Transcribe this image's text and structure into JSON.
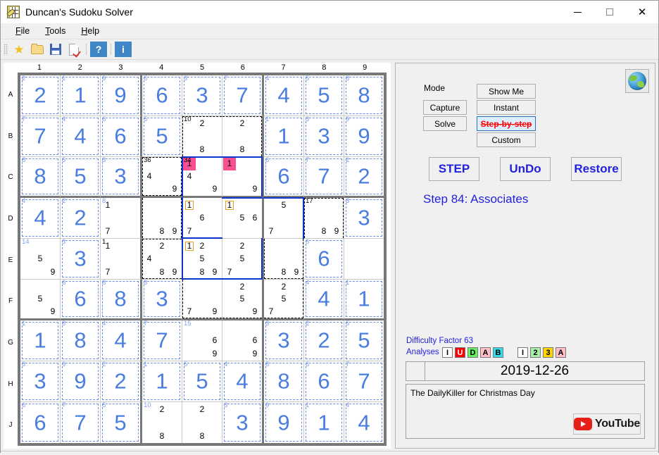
{
  "window": {
    "title": "Duncan's Sudoku Solver",
    "icon": "sudoku-app-icon",
    "minimize": "minimize-icon",
    "maximize": "maximize-icon",
    "close": "close-icon"
  },
  "menu": [
    {
      "label": "File"
    },
    {
      "label": "Tools"
    },
    {
      "label": "Help"
    }
  ],
  "toolbar": [
    {
      "name": "favorite-icon",
      "glyph": "★"
    },
    {
      "name": "open-folder-icon",
      "glyph": ""
    },
    {
      "name": "save-icon",
      "glyph": ""
    },
    {
      "name": "check-page-icon",
      "glyph": ""
    },
    {
      "name": "help-button",
      "glyph": "?"
    },
    {
      "name": "info-button",
      "glyph": "i"
    }
  ],
  "board": {
    "col_headers": [
      "1",
      "2",
      "3",
      "4",
      "5",
      "6",
      "7",
      "8",
      "9"
    ],
    "row_headers": [
      "A",
      "B",
      "C",
      "D",
      "E",
      "F",
      "G",
      "H",
      "J"
    ],
    "cells": [
      [
        {
          "cage": "2",
          "cageColor": "blue",
          "value": "2",
          "solved": true
        },
        {
          "cage": "1",
          "cageColor": "blue",
          "value": "1",
          "solved": true
        },
        {
          "cage": "9",
          "cageColor": "blue",
          "value": "9",
          "solved": true
        },
        {
          "cage": "6",
          "cageColor": "blue",
          "value": "6",
          "solved": true
        },
        {
          "cage": "3",
          "cageColor": "blue",
          "value": "3",
          "solved": true
        },
        {
          "cage": "7",
          "cageColor": "blue",
          "value": "7",
          "solved": true
        },
        {
          "cage": "4",
          "cageColor": "blue",
          "value": "4",
          "solved": true
        },
        {
          "cage": "5",
          "cageColor": "blue",
          "value": "5",
          "solved": true
        },
        {
          "cage": "8",
          "cageColor": "blue",
          "value": "8",
          "solved": true
        }
      ],
      [
        {
          "cage": "7",
          "cageColor": "blue",
          "value": "7",
          "solved": true
        },
        {
          "cage": "4",
          "cageColor": "blue",
          "value": "4",
          "solved": true
        },
        {
          "cage": "6",
          "cageColor": "blue",
          "value": "6",
          "solved": true
        },
        {
          "cage": "5",
          "cageColor": "blue",
          "value": "5",
          "solved": true
        },
        {
          "cage": "10",
          "cageColor": "black",
          "cands": [
            "",
            "2",
            "",
            "",
            "",
            "",
            "",
            "8",
            ""
          ],
          "cg": "TL"
        },
        {
          "cage": "",
          "cands": [
            "",
            "2",
            "",
            "",
            "",
            "",
            "",
            "8",
            ""
          ],
          "cg": "TR"
        },
        {
          "cage": "1",
          "cageColor": "blue",
          "value": "1",
          "solved": true
        },
        {
          "cage": "3",
          "cageColor": "blue",
          "value": "3",
          "solved": true
        },
        {
          "cage": "9",
          "cageColor": "blue",
          "value": "9",
          "solved": true
        }
      ],
      [
        {
          "cage": "8",
          "cageColor": "blue",
          "value": "8",
          "solved": true
        },
        {
          "cage": "5",
          "cageColor": "blue",
          "value": "5",
          "solved": true
        },
        {
          "cage": "3",
          "cageColor": "blue",
          "value": "3",
          "solved": true
        },
        {
          "cage": "36",
          "cageColor": "black",
          "cands": [
            "",
            "",
            "",
            "4",
            "",
            "",
            "",
            "",
            "9"
          ],
          "cg": "TLBR"
        },
        {
          "cage": "34",
          "cageColor": "black",
          "cands": [
            "1h",
            "",
            "",
            "4",
            "",
            "",
            "",
            "",
            "9"
          ],
          "cg": "TL",
          "sel": "TL"
        },
        {
          "cage": "",
          "cands": [
            "1h",
            "",
            "",
            "",
            "",
            "",
            "",
            "",
            "9"
          ],
          "cg": "TR",
          "sel": "TR"
        },
        {
          "cage": "6",
          "cageColor": "blue",
          "value": "6",
          "solved": true
        },
        {
          "cage": "7",
          "cageColor": "blue",
          "value": "7",
          "solved": true
        },
        {
          "cage": "2",
          "cageColor": "blue",
          "value": "2",
          "solved": true
        }
      ],
      [
        {
          "cage": "4",
          "cageColor": "blue",
          "value": "4",
          "solved": true
        },
        {
          "cage": "2",
          "cageColor": "blue",
          "value": "2",
          "solved": true
        },
        {
          "cage": "8",
          "cageColor": "blue",
          "cands": [
            "1",
            "",
            "",
            "",
            "",
            "",
            "7",
            "",
            ""
          ]
        },
        {
          "cage": "",
          "cands": [
            "",
            "",
            "",
            "",
            "",
            "",
            "",
            "8",
            "9"
          ],
          "cg": "LR"
        },
        {
          "cage": "",
          "cands": [
            "1b",
            "",
            "",
            "",
            "6",
            "",
            "7",
            "",
            ""
          ],
          "sel": "LB"
        },
        {
          "cage": "",
          "cands": [
            "1b",
            "",
            "",
            "",
            "5",
            "6",
            "",
            "",
            ""
          ],
          "sel": "T"
        },
        {
          "cage": "",
          "cands": [
            "",
            "5",
            "",
            "",
            "",
            "",
            "7",
            "",
            ""
          ],
          "sel": "TR"
        },
        {
          "cage": "17",
          "cageColor": "black",
          "cands": [
            "",
            "",
            "",
            "",
            "",
            "",
            "",
            "8",
            "9"
          ],
          "cg": "TLR"
        },
        {
          "cage": "3",
          "cageColor": "blue",
          "value": "3",
          "solved": true
        }
      ],
      [
        {
          "cage": "14",
          "cageColor": "blue",
          "cands": [
            "",
            "",
            "",
            "",
            "5",
            "",
            "",
            "",
            "9"
          ]
        },
        {
          "cage": "3",
          "cageColor": "blue",
          "value": "3",
          "solved": true
        },
        {
          "cage": "1",
          "cageColor": "",
          "cands": [
            "1",
            "",
            "",
            "",
            "",
            "",
            "7",
            "",
            ""
          ]
        },
        {
          "cage": "",
          "cands": [
            "",
            "2",
            "",
            "4",
            "",
            "",
            "",
            "8",
            "9"
          ],
          "cg": "TLB"
        },
        {
          "cage": "",
          "cands": [
            "1b",
            "2",
            "",
            "",
            "5",
            "",
            "",
            "8",
            "9"
          ],
          "sel": "LB"
        },
        {
          "cage": "",
          "cands": [
            "",
            "2",
            "",
            "",
            "5",
            "",
            "7",
            "",
            ""
          ],
          "sel": "RB"
        },
        {
          "cage": "",
          "cands": [
            "",
            "",
            "",
            "",
            "",
            "",
            "",
            "8",
            "9"
          ],
          "cg": "LRB"
        },
        {
          "cage": "6",
          "cageColor": "blue",
          "value": "6",
          "solved": true
        }
      ],
      [
        {
          "cage": "",
          "cands": [
            "",
            "",
            "",
            "",
            "5",
            "",
            "",
            "",
            "9"
          ]
        },
        {
          "cage": "6",
          "cageColor": "blue",
          "value": "6",
          "solved": true
        },
        {
          "cage": "8",
          "cageColor": "blue",
          "value": "8",
          "solved": true
        },
        {
          "cage": "3",
          "cageColor": "blue",
          "value": "3",
          "solved": true
        },
        {
          "cage": "",
          "cands": [
            "",
            "",
            "",
            "",
            "",
            "",
            "7",
            "",
            "9"
          ],
          "cg": "LB"
        },
        {
          "cage": "",
          "cands": [
            "",
            "2",
            "",
            "",
            "5",
            "",
            "",
            "",
            "9"
          ],
          "cg": "B"
        },
        {
          "cage": "",
          "cands": [
            "",
            "2",
            "",
            "",
            "5",
            "",
            "7",
            "",
            ""
          ],
          "cg": "BR"
        },
        {
          "cage": "4",
          "cageColor": "blue",
          "value": "4",
          "solved": true
        },
        {
          "cage": "1",
          "cageColor": "blue",
          "value": "1",
          "solved": true
        }
      ],
      [
        {
          "cage": "1",
          "cageColor": "blue",
          "value": "1",
          "solved": true
        },
        {
          "cage": "8",
          "cageColor": "blue",
          "value": "8",
          "solved": true
        },
        {
          "cage": "4",
          "cageColor": "blue",
          "value": "4",
          "solved": true
        },
        {
          "cage": "7",
          "cageColor": "blue",
          "value": "7",
          "solved": true
        },
        {
          "cage": "15",
          "cageColor": "blue",
          "cands": [
            "",
            "",
            "",
            "",
            "",
            "6",
            "",
            "",
            "9"
          ]
        },
        {
          "cage": "",
          "cands": [
            "",
            "",
            "",
            "",
            "",
            "6",
            "",
            "",
            "9"
          ]
        },
        {
          "cage": "3",
          "cageColor": "blue",
          "value": "3",
          "solved": true
        },
        {
          "cage": "2",
          "cageColor": "blue",
          "value": "2",
          "solved": true
        },
        {
          "cage": "5",
          "cageColor": "blue",
          "value": "5",
          "solved": true
        }
      ],
      [
        {
          "cage": "3",
          "cageColor": "blue",
          "value": "3",
          "solved": true
        },
        {
          "cage": "9",
          "cageColor": "blue",
          "value": "9",
          "solved": true
        },
        {
          "cage": "2",
          "cageColor": "blue",
          "value": "2",
          "solved": true
        },
        {
          "cage": "1",
          "cageColor": "blue",
          "value": "1",
          "solved": true
        },
        {
          "cage": "5",
          "cageColor": "blue",
          "value": "5",
          "solved": true
        },
        {
          "cage": "4",
          "cageColor": "blue",
          "value": "4",
          "solved": true
        },
        {
          "cage": "8",
          "cageColor": "blue",
          "value": "8",
          "solved": true
        },
        {
          "cage": "6",
          "cageColor": "blue",
          "value": "6",
          "solved": true
        },
        {
          "cage": "7",
          "cageColor": "blue",
          "value": "7",
          "solved": true
        }
      ],
      [
        {
          "cage": "6",
          "cageColor": "blue",
          "value": "6",
          "solved": true
        },
        {
          "cage": "7",
          "cageColor": "blue",
          "value": "7",
          "solved": true
        },
        {
          "cage": "5",
          "cageColor": "blue",
          "value": "5",
          "solved": true
        },
        {
          "cage": "10",
          "cageColor": "blue",
          "cands": [
            "",
            "2",
            "",
            "",
            "",
            "",
            "",
            "8",
            ""
          ]
        },
        {
          "cage": "",
          "cands": [
            "",
            "2",
            "",
            "",
            "",
            "",
            "",
            "8",
            ""
          ]
        },
        {
          "cage": "3",
          "cageColor": "blue",
          "value": "3",
          "solved": true
        },
        {
          "cage": "9",
          "cageColor": "blue",
          "value": "9",
          "solved": true
        },
        {
          "cage": "1",
          "cageColor": "blue",
          "value": "1",
          "solved": true
        },
        {
          "cage": "4",
          "cageColor": "blue",
          "value": "4",
          "solved": true
        }
      ]
    ]
  },
  "panel": {
    "mode_label": "Mode",
    "capture": "Capture",
    "solve": "Solve",
    "show_me": "Show Me",
    "instant": "Instant",
    "step_by_step": "Step-by-step",
    "custom": "Custom",
    "step": "STEP",
    "undo": "UnDo",
    "restore": "Restore",
    "step_status": "Step 84: Associates",
    "globe_icon": "globe-icon",
    "difficulty": "Difficulty Factor 63",
    "analyses_label": "Analyses",
    "badges": [
      {
        "text": "I",
        "bg": "#ffffff",
        "fg": "#000000"
      },
      {
        "text": "U",
        "bg": "#ff0000",
        "fg": "#ffffff"
      },
      {
        "text": "D",
        "bg": "#66ee66",
        "fg": "#000000"
      },
      {
        "text": "A",
        "bg": "#ffc0c8",
        "fg": "#000000"
      },
      {
        "text": "B",
        "bg": "#33dde8",
        "fg": "#000000"
      },
      {
        "text": "I",
        "bg": "#ffffff",
        "fg": "#000000",
        "gap": true
      },
      {
        "text": "2",
        "bg": "#a8eea8",
        "fg": "#000000"
      },
      {
        "text": "3",
        "bg": "#ffd400",
        "fg": "#000000"
      },
      {
        "text": "A",
        "bg": "#ffc0c8",
        "fg": "#000000"
      }
    ],
    "date": "2019-12-26",
    "note": "The DailyKiller for Christmas Day",
    "youtube": "YouTube"
  }
}
